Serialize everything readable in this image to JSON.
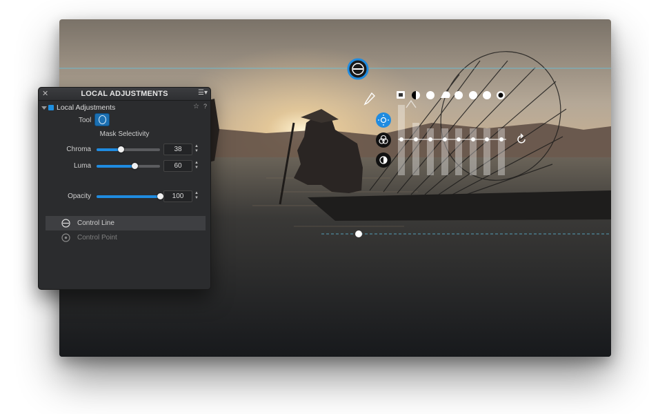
{
  "panel": {
    "title": "LOCAL ADJUSTMENTS",
    "close_label": "✕",
    "menu_label": "☰▾",
    "section_label": "Local Adjustments",
    "pin_label": "☆",
    "help_label": "?",
    "tool_label": "Tool",
    "mask_selectivity_label": "Mask Selectivity",
    "sliders": [
      {
        "label": "Chroma",
        "value": "38",
        "fraction": 0.38
      },
      {
        "label": "Luma",
        "value": "60",
        "fraction": 0.6
      },
      {
        "label": "Opacity",
        "value": "100",
        "fraction": 1.0
      }
    ],
    "list": [
      {
        "label": "Control Line",
        "selected": true
      },
      {
        "label": "Control Point",
        "selected": false
      }
    ]
  },
  "colors": {
    "accent": "#1f8be0",
    "panel_bg": "#2b2c2e"
  },
  "icons": {
    "control_line_handle": "target-icon",
    "eyedropper": "eyedropper-icon",
    "brightness": "sun-icon",
    "color": "rgb-circles-icon",
    "structure": "contrast-dial-icon",
    "reset": "reset-arrow-icon"
  }
}
